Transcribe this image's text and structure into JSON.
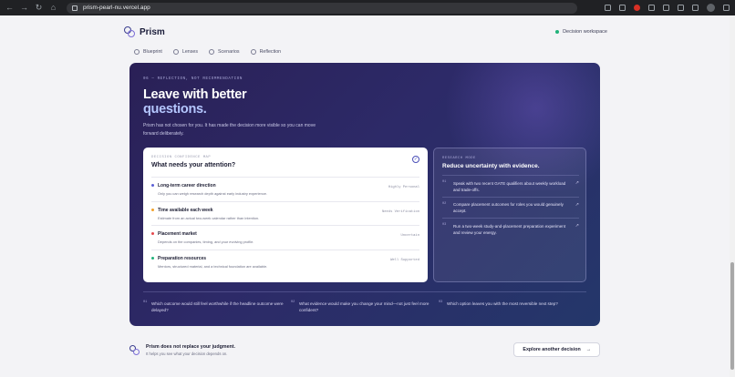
{
  "browser": {
    "url": "prism-pearl-nu.vercel.app"
  },
  "header": {
    "brand": "Prism",
    "workspace_label": "Decision workspace"
  },
  "tabs": [
    {
      "label": "Blueprint",
      "icon": "blueprint-icon"
    },
    {
      "label": "Lenses",
      "icon": "lenses-icon"
    },
    {
      "label": "Scenarios",
      "icon": "scenarios-icon"
    },
    {
      "label": "Reflection",
      "icon": "lightbulb-icon"
    }
  ],
  "hero": {
    "eyebrow": "06 — REFLECTION, NOT RECOMMENDATION",
    "title_line1": "Leave with better",
    "title_line2": "questions.",
    "lead": "Prism has not chosen for you. It has made the decision more visible so you can move forward deliberately."
  },
  "attention": {
    "eyebrow": "DECISION CONFIDENCE MAP",
    "title": "What needs your attention?",
    "rows": [
      {
        "title": "Long-term career direction",
        "subtitle": "Only you can weigh research depth against early industry experience.",
        "tag": "Highly Personal",
        "color": "#5b5fd6"
      },
      {
        "title": "Time available each week",
        "subtitle": "Estimate from an actual two-week calendar rather than intention.",
        "tag": "Needs Verification",
        "color": "#f2a12b"
      },
      {
        "title": "Placement market",
        "subtitle": "Depends on the companies, timing, and your evolving profile.",
        "tag": "Uncertain",
        "color": "#e5484d"
      },
      {
        "title": "Preparation resources",
        "subtitle": "Mentors, structured material, and a technical foundation are available.",
        "tag": "Well Supported",
        "color": "#20b27a"
      }
    ]
  },
  "research": {
    "eyebrow": "RESEARCH MODE",
    "title": "Reduce uncertainty with evidence.",
    "items": [
      {
        "num": "01",
        "text": "Speak with two recent GATE qualifiers about weekly workload and trade-offs."
      },
      {
        "num": "02",
        "text": "Compare placement outcomes for roles you would genuinely accept."
      },
      {
        "num": "03",
        "text": "Run a two-week study-and-placement preparation experiment and review your energy."
      }
    ]
  },
  "questions": [
    {
      "num": "01",
      "text": "Which outcome would still feel worthwhile if the headline outcome were delayed?"
    },
    {
      "num": "02",
      "text": "What evidence would make you change your mind—not just feel more confident?"
    },
    {
      "num": "03",
      "text": "Which option leaves you with the most reversible next step?"
    }
  ],
  "footer": {
    "line1": "Prism does not replace your judgment.",
    "line2": "It helps you see what your decision depends on.",
    "button": "Explore another decision"
  }
}
